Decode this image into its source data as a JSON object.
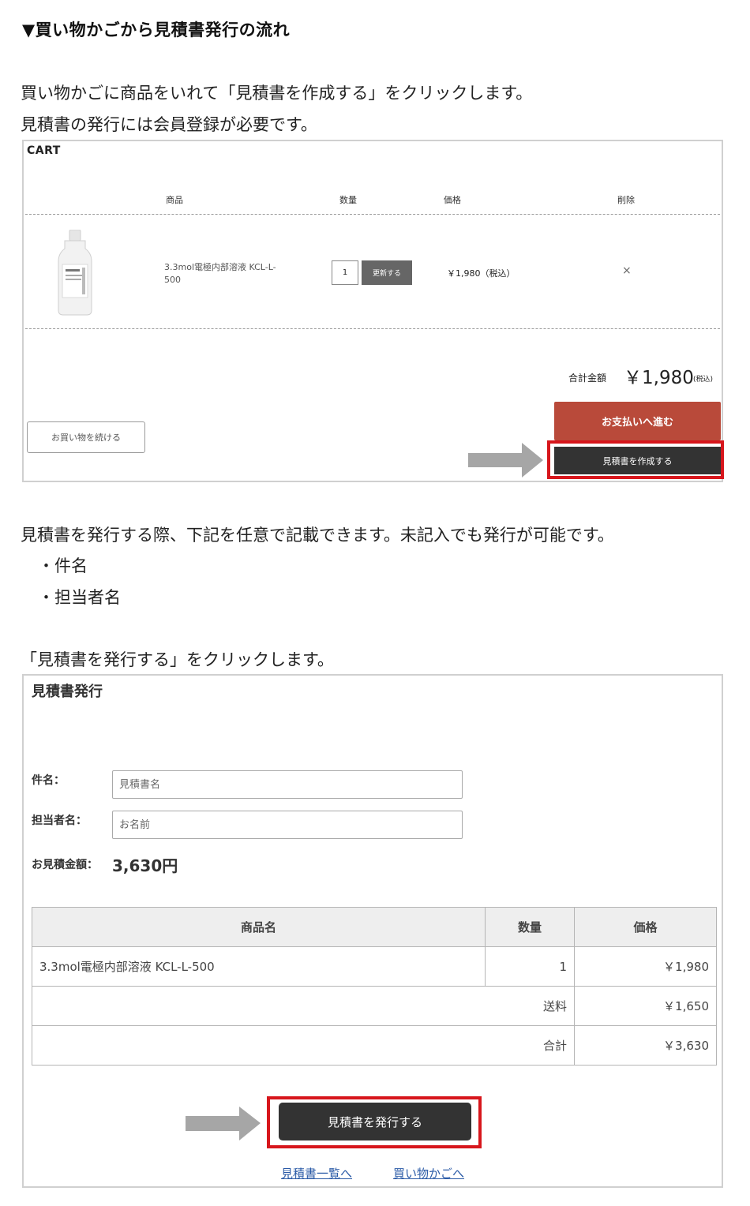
{
  "heading": "▼買い物かごから見積書発行の流れ",
  "intro": {
    "line1": "買い物かごに商品をいれて「見積書を作成する」をクリックします。",
    "line2": "見積書の発行には会員登録が必要です。"
  },
  "cart": {
    "title": "CART",
    "columns": {
      "product": "商品",
      "quantity": "数量",
      "price": "価格",
      "delete": "削除"
    },
    "item": {
      "name": "3.3mol電極内部溶液 KCL-L-500",
      "quantity": "1",
      "update_label": "更新する",
      "price": "￥1,980（税込）",
      "delete_symbol": "×"
    },
    "total_label": "合計金額",
    "total_amount": "￥1,980",
    "total_tax": "(税込)",
    "continue_label": "お買い物を続ける",
    "checkout_label": "お支払いへ進む",
    "create_estimate_label": "見積書を作成する"
  },
  "middle": {
    "line1": "見積書を発行する際、下記を任意で記載できます。未記入でも発行が可能です。",
    "bullet1": "・件名",
    "bullet2": "・担当者名",
    "click_instruction": "「見積書を発行する」をクリックします。"
  },
  "quote": {
    "title": "見積書発行",
    "subject_label": "件名：",
    "subject_placeholder": "見積書名",
    "person_label": "担当者名：",
    "person_placeholder": "お名前",
    "amount_label": "お見積金額：",
    "amount_value": "3,630円",
    "table": {
      "headers": {
        "name": "商品名",
        "quantity": "数量",
        "price": "価格"
      },
      "item_name": "3.3mol電極内部溶液 KCL-L-500",
      "item_quantity": "1",
      "item_price": "￥1,980",
      "shipping_label": "送料",
      "shipping_price": "￥1,650",
      "total_label": "合計",
      "total_price": "￥3,630"
    },
    "issue_label": "見積書を発行する",
    "link_list": "見積書一覧へ",
    "link_cart": "買い物かごへ"
  },
  "colors": {
    "highlight_frame": "#d7161c",
    "checkout_button": "#b94a3a",
    "dark_button": "#333333",
    "link": "#2b5ba7",
    "arrow": "#a6a6a6"
  }
}
